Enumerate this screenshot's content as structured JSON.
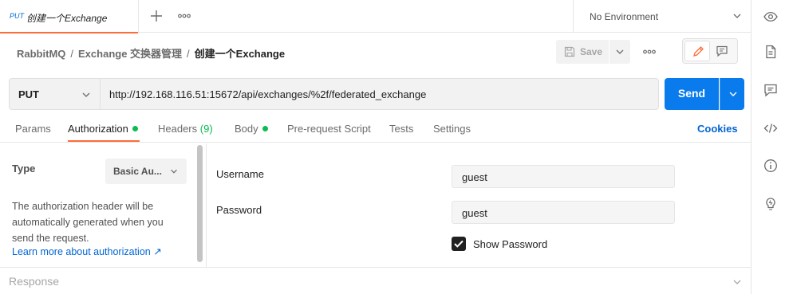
{
  "tab": {
    "method": "PUT",
    "name": "创建一个Exchange"
  },
  "environment": {
    "selected": "No Environment"
  },
  "breadcrumb": {
    "collection": "RabbitMQ",
    "folder": "Exchange 交换器管理",
    "request": "创建一个Exchange",
    "separator": "/"
  },
  "toolbar": {
    "save_label": "Save"
  },
  "request": {
    "method": "PUT",
    "url": "http://192.168.116.51:15672/api/exchanges/%2f/federated_exchange",
    "send_label": "Send"
  },
  "request_tabs": {
    "params": "Params",
    "authorization": "Authorization",
    "headers": "Headers",
    "headers_count": "(9)",
    "body": "Body",
    "prerequest": "Pre-request Script",
    "tests": "Tests",
    "settings": "Settings",
    "cookies": "Cookies"
  },
  "auth": {
    "type_label": "Type",
    "type_value": "Basic Au...",
    "description": "The authorization header will be automatically generated when you send the request.",
    "learn_more": "Learn more about authorization ↗",
    "username_label": "Username",
    "username_value": "guest",
    "password_label": "Password",
    "password_value": "guest",
    "show_password_label": "Show Password",
    "show_password_checked": true
  },
  "response": {
    "label": "Response"
  },
  "colors": {
    "accent": "#ff6c37",
    "send_blue": "#097bed",
    "link_blue": "#0265d2",
    "status_green": "#0cbb52"
  },
  "icons": [
    "plus-icon",
    "more-horizontal-icon",
    "chevron-down-icon",
    "eye-icon",
    "save-icon",
    "pencil-icon",
    "comment-icon",
    "document-icon",
    "code-icon",
    "info-icon",
    "lightbulb-icon",
    "checkmark-icon"
  ]
}
